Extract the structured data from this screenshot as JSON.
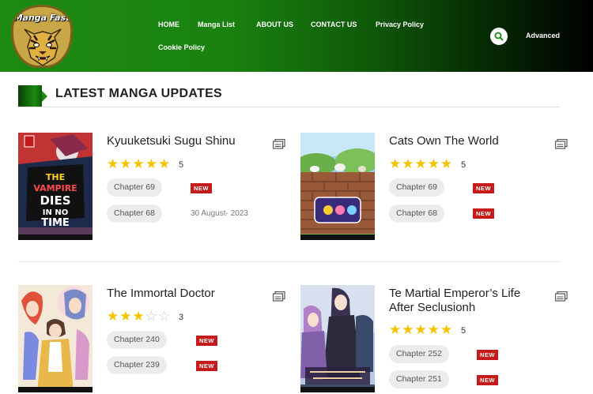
{
  "logo": {
    "text": "Manga Fast"
  },
  "nav": {
    "items": [
      "HOME",
      "Manga List",
      "ABOUT US",
      "CONTACT US",
      "Privacy Policy",
      "Cookie Policy"
    ],
    "advanced": "Advanced"
  },
  "section": {
    "title": "LATEST MANGA UPDATES"
  },
  "colors": {
    "header_green": "#1e8a12",
    "star": "#f5c400",
    "badge_red": "#c41a1a"
  },
  "manga": [
    {
      "title": "Kyuuketsuki Sugu Shinu",
      "rating": "5",
      "stars_filled": 5,
      "chapters": [
        {
          "label": "Chapter 69",
          "badge": "NEW",
          "date": ""
        },
        {
          "label": "Chapter 68",
          "badge": "",
          "date": "30 August- 2023"
        }
      ]
    },
    {
      "title": "Cats Own The World",
      "rating": "5",
      "stars_filled": 5,
      "chapters": [
        {
          "label": "Chapter 69",
          "badge": "NEW",
          "date": ""
        },
        {
          "label": "Chapter 68",
          "badge": "NEW",
          "date": ""
        }
      ]
    },
    {
      "title": "The Immortal Doctor",
      "rating": "3",
      "stars_filled": 3,
      "chapters": [
        {
          "label": "Chapter 240",
          "badge": "NEW",
          "date": ""
        },
        {
          "label": "Chapter 239",
          "badge": "NEW",
          "date": ""
        }
      ]
    },
    {
      "title": "Te Martial Emperor’s Life After Seclusionh",
      "rating": "5",
      "stars_filled": 5,
      "chapters": [
        {
          "label": "Chapter 252",
          "badge": "NEW",
          "date": ""
        },
        {
          "label": "Chapter 251",
          "badge": "NEW",
          "date": ""
        }
      ]
    }
  ]
}
